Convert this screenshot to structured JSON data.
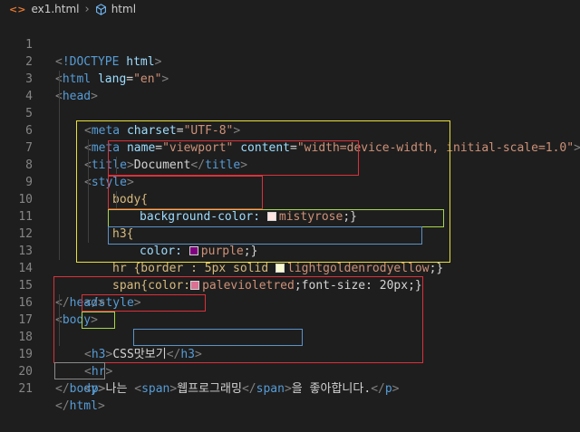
{
  "breadcrumb": {
    "file_icon": "<>",
    "file": "ex1.html",
    "item_icon": "cube-icon",
    "item": "html"
  },
  "lines": [
    {
      "n": "1"
    },
    {
      "n": "2"
    },
    {
      "n": "3"
    },
    {
      "n": "4"
    },
    {
      "n": "5"
    },
    {
      "n": "6"
    },
    {
      "n": "7"
    },
    {
      "n": "8"
    },
    {
      "n": "9"
    },
    {
      "n": "10"
    },
    {
      "n": "11"
    },
    {
      "n": "12"
    },
    {
      "n": "13"
    },
    {
      "n": "14"
    },
    {
      "n": "15"
    },
    {
      "n": "16"
    },
    {
      "n": "17"
    },
    {
      "n": "18"
    },
    {
      "n": "19"
    },
    {
      "n": "20"
    },
    {
      "n": "21"
    }
  ],
  "code": {
    "doctype": "!DOCTYPE",
    "html": "html",
    "lang_attr": "lang",
    "lang_val": "\"en\"",
    "head": "head",
    "meta": "meta",
    "charset_attr": "charset",
    "charset_val": "\"UTF-8\"",
    "name_attr": "name",
    "name_val": "\"viewport\"",
    "content_attr": "content",
    "content_val": "\"width=device-width, initial-scale=1.0\"",
    "title": "title",
    "title_text": "Document",
    "style": "style",
    "body_sel": "body{",
    "bg_prop": "background-color:",
    "bg_val": "mistyrose",
    "bg_color": "#ffe4e1",
    "h3_sel": "h3{",
    "color_prop": "color:",
    "color_val": "purple",
    "purple_color": "#800080",
    "hr_rule_a": "hr {border : 5px solid ",
    "hr_val": "lightgoldenrodyellow",
    "hr_color": "#fafad2",
    "span_rule_a": "span{color:",
    "span_val": "palevioletred",
    "span_color": "#db7093",
    "span_rule_b": ";font-size: 20px;}",
    "body": "body",
    "h3": "h3",
    "h3_text": "CSS맛보기",
    "hr": "hr",
    "p": "p",
    "p_text_a": "나는 ",
    "span": "span",
    "span_text": "웹프로그래밍",
    "p_text_b": "을 좋아합니다."
  },
  "box_colors": {
    "yellow": "#e8e03a",
    "red": "#d9313b",
    "green": "#a6d64a",
    "blue": "#5b92c9"
  }
}
